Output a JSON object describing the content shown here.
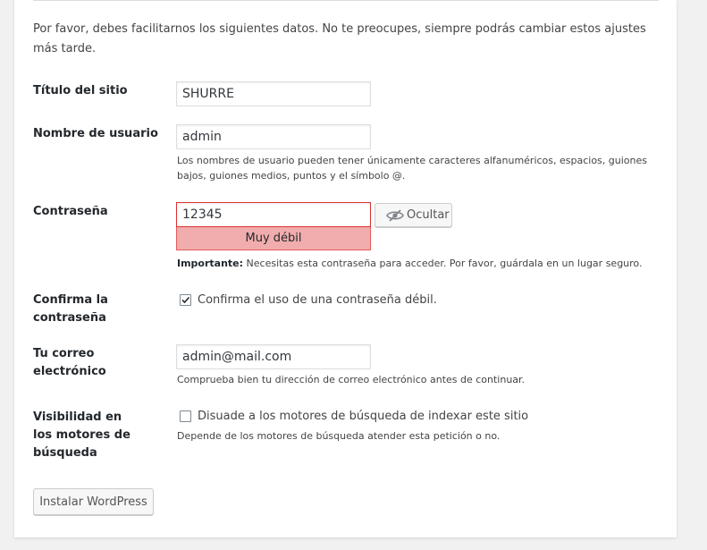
{
  "intro": "Por favor, debes facilitarnos los siguientes datos. No te preocupes, siempre podrás cambiar estos ajustes más tarde.",
  "site_title": {
    "label": "Título del sitio",
    "value": "SHURRE"
  },
  "username": {
    "label": "Nombre de usuario",
    "value": "admin",
    "description": "Los nombres de usuario pueden tener únicamente caracteres alfanuméricos, espacios, guiones bajos, guiones medios, puntos y el símbolo @."
  },
  "password": {
    "label": "Contraseña",
    "value": "12345",
    "strength": "Muy débil",
    "toggle_label": "Ocultar",
    "toggle_icon": "eye-slash-icon",
    "important_prefix": "Importante:",
    "important_text": " Necesitas esta contraseña para acceder. Por favor, guárdala en un lugar seguro."
  },
  "confirm_weak": {
    "label": "Confirma la contraseña",
    "checkbox_label": "Confirma el uso de una contraseña débil.",
    "checked": true
  },
  "email": {
    "label": "Tu correo electrónico",
    "value": "admin@mail.com",
    "description": "Comprueba bien tu dirección de correo electrónico antes de continuar."
  },
  "visibility": {
    "label": "Visibilidad en los motores de búsqueda",
    "checkbox_label": "Disuade a los motores de búsqueda de indexar este sitio",
    "checked": false,
    "description": "Depende de los motores de búsqueda atender esta petición o no."
  },
  "install_button": "Instalar WordPress",
  "colors": {
    "weak_bg": "#f1adad",
    "weak_border": "#dc3232",
    "page_bg": "#f1f1f1"
  }
}
